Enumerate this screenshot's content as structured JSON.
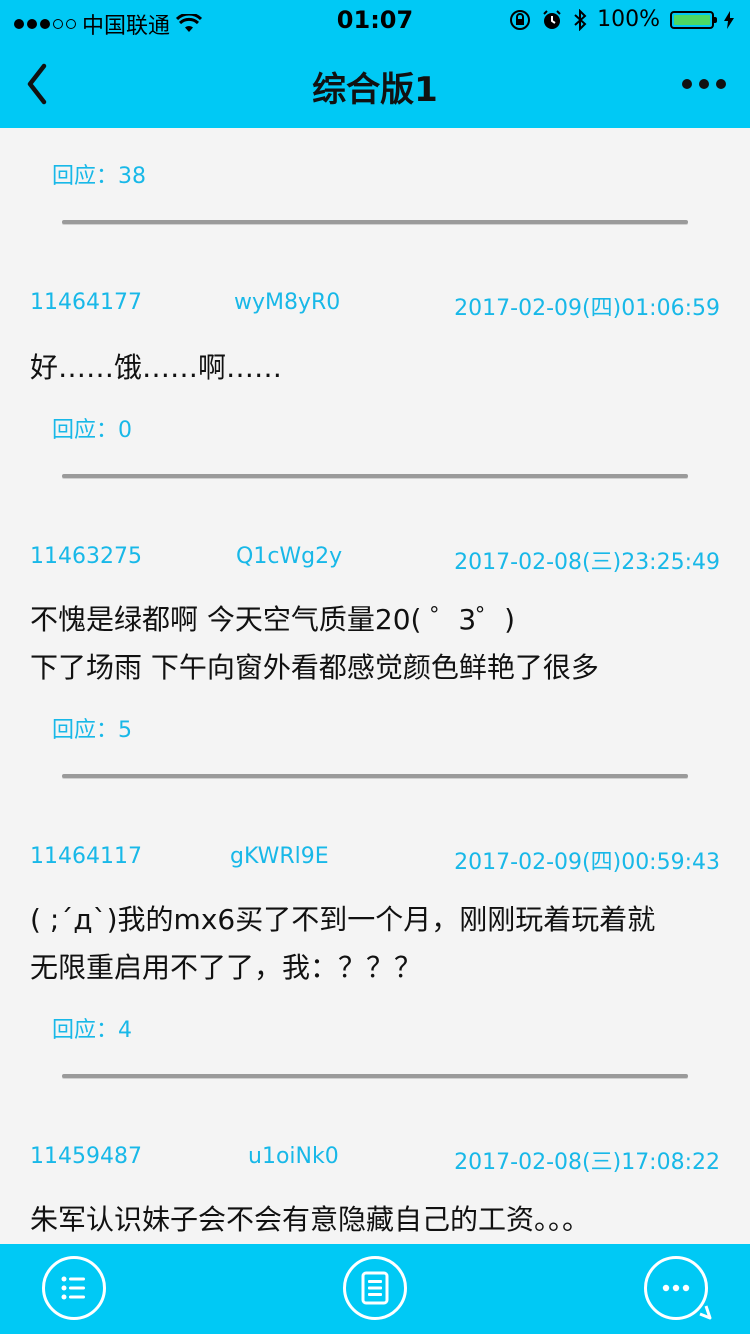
{
  "status_bar": {
    "carrier": "中国联通",
    "time": "01:07",
    "battery": "100%"
  },
  "nav": {
    "title": "综合版1"
  },
  "top_reply": "回应：38",
  "posts": [
    {
      "id": "11464177",
      "user": "wyM8yR0",
      "date": "2017-02-09(四)01:06:59",
      "content": "好……饿……啊……",
      "reply": "回应：0"
    },
    {
      "id": "11463275",
      "user": "Q1cWg2y",
      "date": "2017-02-08(三)23:25:49",
      "content": "不愧是绿都啊 今天空气质量20( ゜3゜)\n下了场雨 下午向窗外看都感觉颜色鲜艳了很多",
      "reply": "回应：5"
    },
    {
      "id": "11464117",
      "user": "gKWRl9E",
      "date": "2017-02-09(四)00:59:43",
      "content": "( ;´д`)我的mx6买了不到一个月，刚刚玩着玩着就\n无限重启用不了了，我：？？？",
      "reply": "回应：4"
    },
    {
      "id": "11459487",
      "user": "u1oiNk0",
      "date": "2017-02-08(三)17:08:22",
      "content": "朱军认识妹子会不会有意隐藏自己的工资。。。"
    }
  ],
  "tabs": [
    {
      "icon": "list-icon"
    },
    {
      "icon": "document-icon"
    },
    {
      "icon": "chat-icon"
    }
  ],
  "colors": {
    "accent": "#00c9f5",
    "link": "#18b8e8",
    "background": "#f4f4f4"
  }
}
